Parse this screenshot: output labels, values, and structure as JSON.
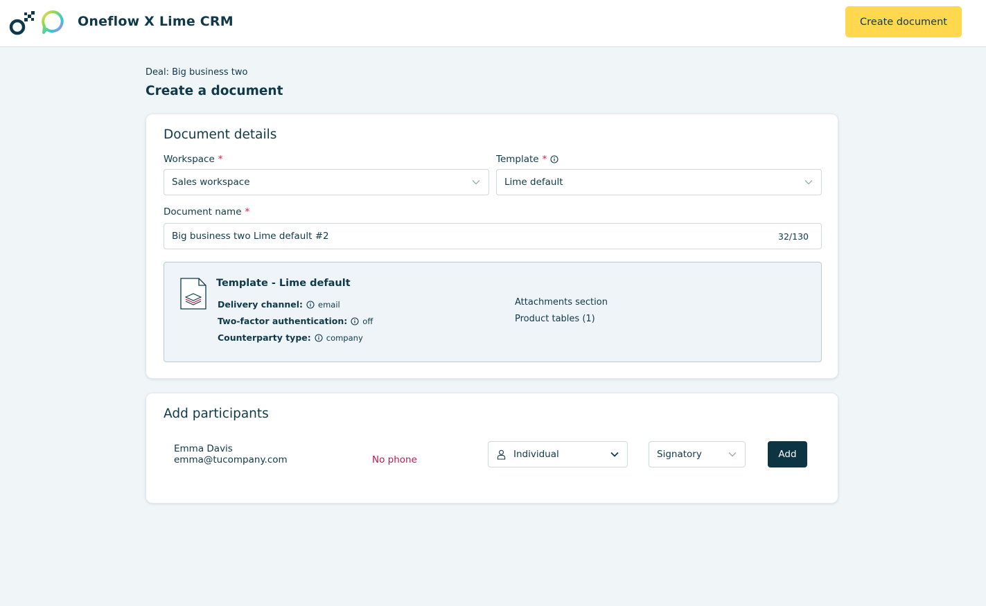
{
  "header": {
    "title": "Oneflow X Lime CRM",
    "create_button": "Create document"
  },
  "page": {
    "deal_label": "Deal: Big business two",
    "title": "Create a document"
  },
  "document_details": {
    "title": "Document details",
    "workspace_label": "Workspace",
    "workspace_value": "Sales workspace",
    "template_label": "Template",
    "template_value": "Lime default",
    "required_mark": "*",
    "document_name_label": "Document name",
    "document_name_value": "Big business two Lime default #2",
    "char_counter": "32/130",
    "template_info": {
      "title": "Template - Lime default",
      "delivery_channel_label": "Delivery channel:",
      "delivery_channel_value": "email",
      "two_factor_label": "Two-factor authentication:",
      "two_factor_value": "off",
      "counterparty_label": "Counterparty type:",
      "counterparty_value": "company",
      "attachments": "Attachments section",
      "product_tables": "Product tables (1)"
    }
  },
  "participants": {
    "title": "Add participants",
    "name": "Emma Davis",
    "email": "emma@tucompany.com",
    "phone": "No phone",
    "type_value": "Individual",
    "role_value": "Signatory",
    "add_button": "Add"
  },
  "colors": {
    "primary": "#0f3948",
    "accent_yellow": "#ffd84d",
    "required_red": "#d6164a",
    "background": "#f0f5f8"
  }
}
